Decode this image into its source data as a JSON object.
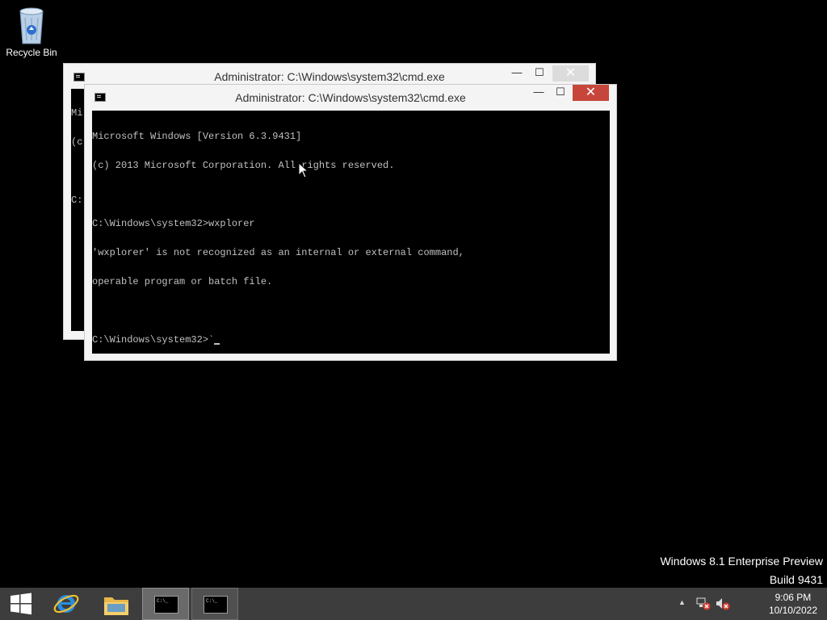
{
  "desktop": {
    "recycle_bin_label": "Recycle Bin",
    "watermark_line1": "Windows 8.1 Enterprise Preview",
    "watermark_line2": "Build 9431"
  },
  "back_window": {
    "title": "Administrator: C:\\Windows\\system32\\cmd.exe",
    "lines": [
      "Mi",
      "(c",
      "",
      "C:"
    ]
  },
  "front_window": {
    "title": "Administrator: C:\\Windows\\system32\\cmd.exe",
    "minimize": "—",
    "maximize": "☐",
    "close": "✕",
    "lines": [
      "Microsoft Windows [Version 6.3.9431]",
      "(c) 2013 Microsoft Corporation. All rights reserved.",
      "",
      "C:\\Windows\\system32>wxplorer",
      "'wxplorer' is not recognized as an internal or external command,",
      "operable program or batch file.",
      "",
      "C:\\Windows\\system32>`"
    ]
  },
  "taskbar": {
    "items": [
      {
        "name": "start",
        "icon": "windows-logo-icon"
      },
      {
        "name": "internet-explorer",
        "icon": "internet-explorer-icon"
      },
      {
        "name": "file-explorer",
        "icon": "folder-icon"
      },
      {
        "name": "cmd-1",
        "icon": "cmd-icon",
        "state": "active"
      },
      {
        "name": "cmd-2",
        "icon": "cmd-icon",
        "state": "running"
      }
    ],
    "tray": {
      "show_hidden": "▲",
      "network_icon": "network-error-icon",
      "volume_icon": "volume-muted-icon"
    },
    "clock": {
      "time": "9:06 PM",
      "date": "10/10/2022"
    }
  },
  "colors": {
    "desktop": "#000000",
    "taskbar": "#3d3d3d",
    "close_active": "#c7463b",
    "window_frame": "#f4f4f4",
    "console_text": "#c0c0c0"
  }
}
